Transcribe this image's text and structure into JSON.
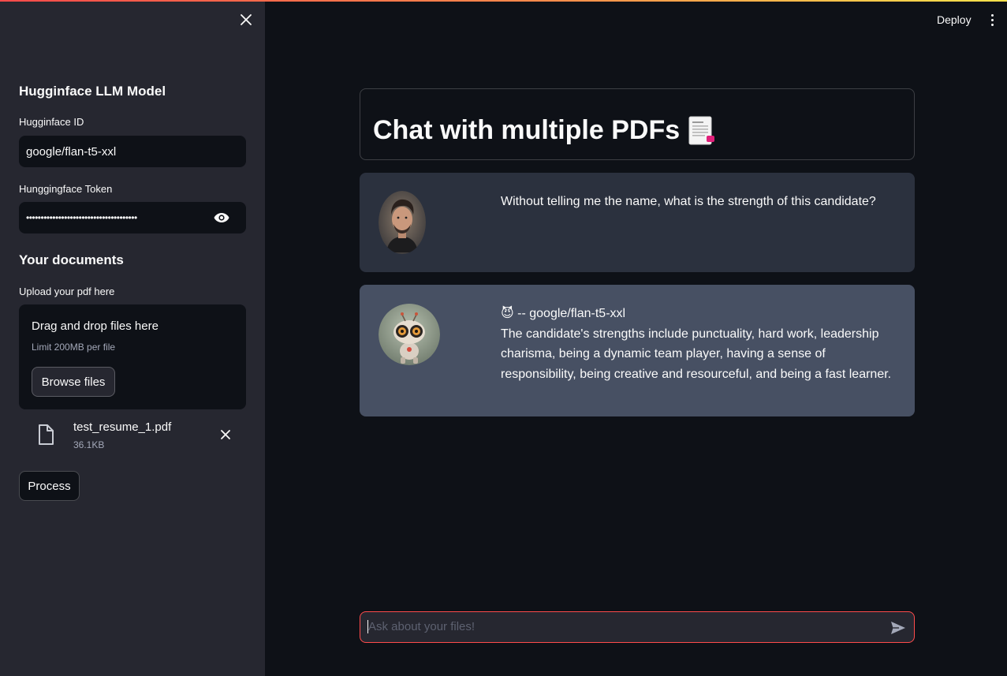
{
  "header": {
    "deploy_label": "Deploy"
  },
  "sidebar": {
    "section_model": "Hugginface LLM Model",
    "id_label": "Hugginface ID",
    "id_value": "google/flan-t5-xxl",
    "token_label": "Hunggingface Token",
    "token_value": "••••••••••••••••••••••••••••••••••••••",
    "section_docs": "Your documents",
    "upload_label": "Upload your pdf here",
    "dropzone_title": "Drag and drop files here",
    "dropzone_limit": "Limit 200MB per file",
    "browse_label": "Browse files",
    "file": {
      "name": "test_resume_1.pdf",
      "size": "36.1KB"
    },
    "process_label": "Process"
  },
  "main": {
    "title": "Chat with multiple PDFs",
    "title_emoji": "📄",
    "messages": [
      {
        "role": "user",
        "text": "Without telling me the name, what is the strength of this candidate?"
      },
      {
        "role": "bot",
        "model_prefix": "😈",
        "model_label": "-- google/flan-t5-xxl",
        "text": "The candidate's strengths include punctuality, hard work, leadership charisma, being a dynamic team player, having a sense of responsibility, being creative and resourceful, and being a fast learner."
      }
    ],
    "chat_placeholder": "Ask about your files!"
  },
  "colors": {
    "background": "#0e1117",
    "sidebar": "#262730",
    "user_message": "#2b313e",
    "bot_message": "#475063",
    "accent": "#ff4b4b"
  }
}
